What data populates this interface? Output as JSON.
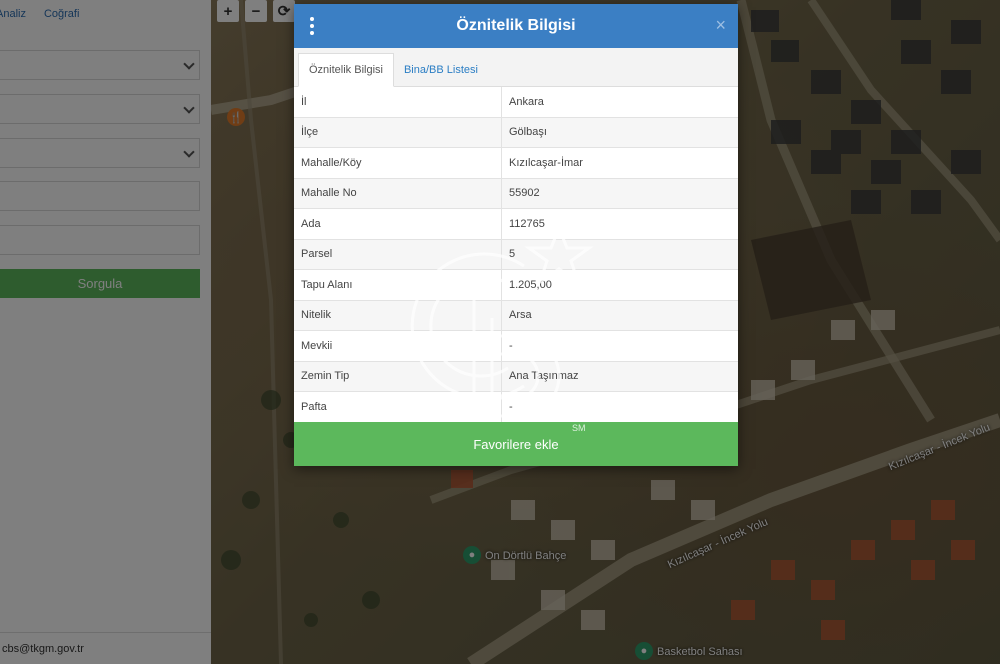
{
  "sidebar": {
    "tabs": [
      "Analiz",
      "Coğrafi"
    ],
    "query_button": "Sorgula",
    "footer_email": "cbs@tkgm.gov.tr"
  },
  "map": {
    "toolbar": {
      "zoom_in": "+",
      "zoom_out": "−",
      "refresh": "⟳"
    },
    "labels": {
      "road": "Kızılcaşar - İncek Yolu",
      "road2": "Kızılcaşar - İncek Yolu",
      "poi_garden": "On Dörtlü Bahçe",
      "poi_court": "Basketbol Sahası"
    }
  },
  "modal": {
    "title": "Öznitelik Bilgisi",
    "close": "×",
    "tabs": [
      {
        "label": "Öznitelik Bilgisi",
        "active": true
      },
      {
        "label": "Bina/BB Listesi",
        "active": false
      }
    ],
    "rows": [
      {
        "key": "İl",
        "value": "Ankara"
      },
      {
        "key": "İlçe",
        "value": "Gölbaşı"
      },
      {
        "key": "Mahalle/Köy",
        "value": "Kızılcaşar-İmar"
      },
      {
        "key": "Mahalle No",
        "value": "55902"
      },
      {
        "key": "Ada",
        "value": "112765"
      },
      {
        "key": "Parsel",
        "value": "5"
      },
      {
        "key": "Tapu Alanı",
        "value": "1.205,00"
      },
      {
        "key": "Nitelik",
        "value": "Arsa"
      },
      {
        "key": "Mevkii",
        "value": "-"
      },
      {
        "key": "Zemin Tip",
        "value": "Ana Taşınmaz"
      },
      {
        "key": "Pafta",
        "value": "-"
      }
    ],
    "favorite_button": "Favorilere ekle"
  },
  "watermark": {
    "mark": "SM"
  },
  "colors": {
    "header": "#3b7fc4",
    "button": "#5cb85c",
    "link": "#2b7ec4"
  }
}
